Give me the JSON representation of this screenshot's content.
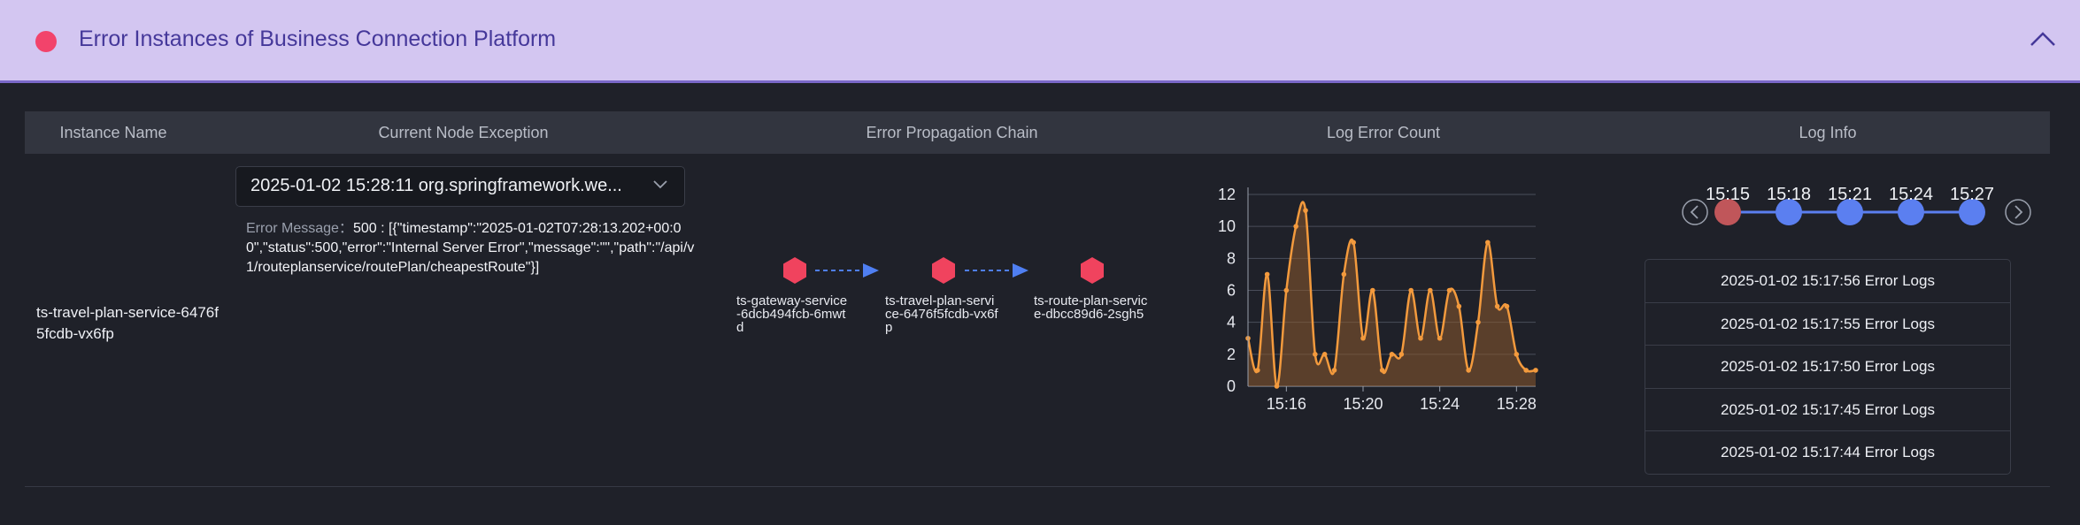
{
  "header": {
    "title": "Error Instances of Business Connection Platform",
    "status_color": "#f2436b"
  },
  "table": {
    "columns": [
      "Instance Name",
      "Current Node Exception",
      "Error Propagation Chain",
      "Log Error Count",
      "Log Info"
    ]
  },
  "row": {
    "instance_name": "ts-travel-plan-service-6476f5fcdb-vx6fp",
    "exception_select": "2025-01-02 15:28:11 org.springframework.we...",
    "error_message_label": "Error Message：",
    "error_message": "500 : [{\"timestamp\":\"2025-01-02T07:28:13.202+00:00\",\"status\":500,\"error\":\"Internal Server Error\",\"message\":\"\",\"path\":\"/api/v1/routeplanservice/routePlan/cheapestRoute\"}]",
    "chain": [
      {
        "name": "ts-gateway-service-6dcb494fcb-6mwtd"
      },
      {
        "name": "ts-travel-plan-service-6476f5fcdb-vx6fp"
      },
      {
        "name": "ts-route-plan-service-dbcc89d6-2sgh5"
      }
    ],
    "log_info": {
      "timeline": [
        "15:15",
        "15:18",
        "15:21",
        "15:24",
        "15:27"
      ],
      "selected_index": 0,
      "logs": [
        "2025-01-02 15:17:56 Error Logs",
        "2025-01-02 15:17:55 Error Logs",
        "2025-01-02 15:17:50 Error Logs",
        "2025-01-02 15:17:45 Error Logs",
        "2025-01-02 15:17:44 Error Logs"
      ]
    }
  },
  "chart_data": {
    "type": "area",
    "title": "",
    "xlabel": "",
    "ylabel": "",
    "x_tick_labels": [
      "15:16",
      "15:20",
      "15:24",
      "15:28"
    ],
    "y_ticks": [
      0,
      2,
      4,
      6,
      8,
      10,
      12
    ],
    "ylim": [
      0,
      12
    ],
    "grid": true,
    "color": "#f39a3d",
    "x": [
      "15:14",
      "15:14.5",
      "15:15",
      "15:15.5",
      "15:16",
      "15:16.5",
      "15:17",
      "15:17.5",
      "15:18",
      "15:18.5",
      "15:19",
      "15:19.5",
      "15:20",
      "15:20.5",
      "15:21",
      "15:21.5",
      "15:22",
      "15:22.5",
      "15:23",
      "15:23.5",
      "15:24",
      "15:24.5",
      "15:25",
      "15:25.5",
      "15:26",
      "15:26.5",
      "15:27",
      "15:27.5",
      "15:28",
      "15:28.5",
      "15:29"
    ],
    "values": [
      3,
      1,
      7,
      0,
      6,
      10,
      11,
      2,
      2,
      1,
      7,
      9,
      3,
      6,
      1,
      2,
      2,
      6,
      3,
      6,
      3,
      6,
      5,
      1,
      4,
      9,
      5,
      5,
      2,
      1,
      1
    ]
  }
}
